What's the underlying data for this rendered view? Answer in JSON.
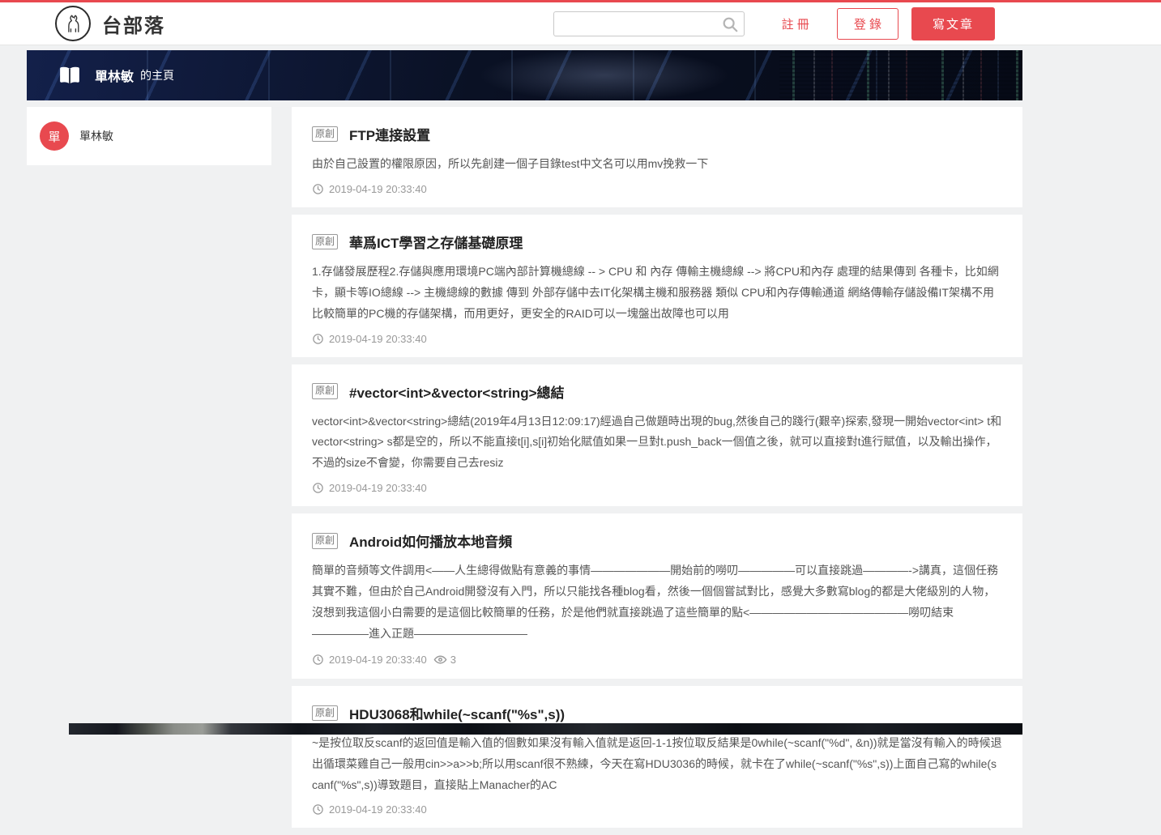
{
  "page": {
    "bg_color": "#f0f1f2",
    "accent_color": "#e8494f",
    "banner_color": "#0a1124"
  },
  "header": {
    "site_title": "台部落",
    "search": {
      "value": "",
      "placeholder": ""
    },
    "register_label": "註 冊",
    "login_label": "登 錄",
    "write_label": "寫文章"
  },
  "hero": {
    "user_name": "單林敏",
    "suffix": "的主頁"
  },
  "sidebar": {
    "avatar_char": "單",
    "user_name": "單林敏"
  },
  "articles": [
    {
      "tag": "原創",
      "title": "FTP連接設置",
      "excerpt": "由於自己設置的權限原因，所以先創建一個子目錄test中文名可以用mv挽救一下",
      "date": "2019-04-19 20:33:40"
    },
    {
      "tag": "原創",
      "title": "華爲ICT學習之存儲基礎原理",
      "excerpt": "1.存儲發展歷程2.存儲與應用環境PC端內部計算機總線 -- > CPU 和 內存 傳輸主機總線 --> 將CPU和內存 處理的結果傳到 各種卡，比如網卡，顯卡等IO總線 --> 主機總線的數據 傳到 外部存儲中去IT化架構主機和服務器 類似 CPU和內存傳輸通道 網絡傳輸存儲設備IT架構不用比較簡單的PC機的存儲架構，而用更好，更安全的RAID可以一塊盤出故障也可以用",
      "date": "2019-04-19 20:33:40"
    },
    {
      "tag": "原創",
      "title": "#vector<int>&vector<string>總結",
      "excerpt": "vector<int>&vector<string>總結(2019年4月13日12:09:17)經過自己做題時出現的bug,然後自己的踐行(艱辛)探索,發現一開始vector<int> t和vector<string> s都是空的，所以不能直接t[i],s[i]初始化賦值如果一旦對t.push_back一個值之後，就可以直接對t進行賦值，以及輸出操作，不過的size不會變，你需要自己去resiz",
      "date": "2019-04-19 20:33:40"
    },
    {
      "tag": "原創",
      "title": "Android如何播放本地音頻",
      "excerpt": "簡單的音頻等文件調用<——人生總得做點有意義的事情———————開始前的嘮叨—————可以直接跳過————->講真，這個任務其實不難，但由於自己Android開發沒有入門，所以只能找各種blog看，然後一個個嘗試對比，感覺大多數寫blog的都是大佬級別的人物，沒想到我這個小白需要的是這個比較簡單的任務，於是他們就直接跳過了這些簡單的點<——————————————嘮叨結束—————進入正題——————————",
      "date": "2019-04-19 20:33:40",
      "views": "3"
    },
    {
      "tag": "原創",
      "title": "HDU3068和while(~scanf(\"%s\",s))",
      "excerpt": "~是按位取反scanf的返回值是輸入值的個數如果沒有輸入值就是返回-1-1按位取反結果是0while(~scanf(\"%d\", &n))就是當沒有輸入的時候退出循環菜雞自己一般用cin>>a>>b;所以用scanf很不熟練，今天在寫HDU3036的時候，就卡在了while(~scanf(\"%s\",s))上面自己寫的while(scanf(\"%s\",s))導致題目，直接貼上Manacher的AC",
      "date": "2019-04-19 20:33:40"
    }
  ]
}
